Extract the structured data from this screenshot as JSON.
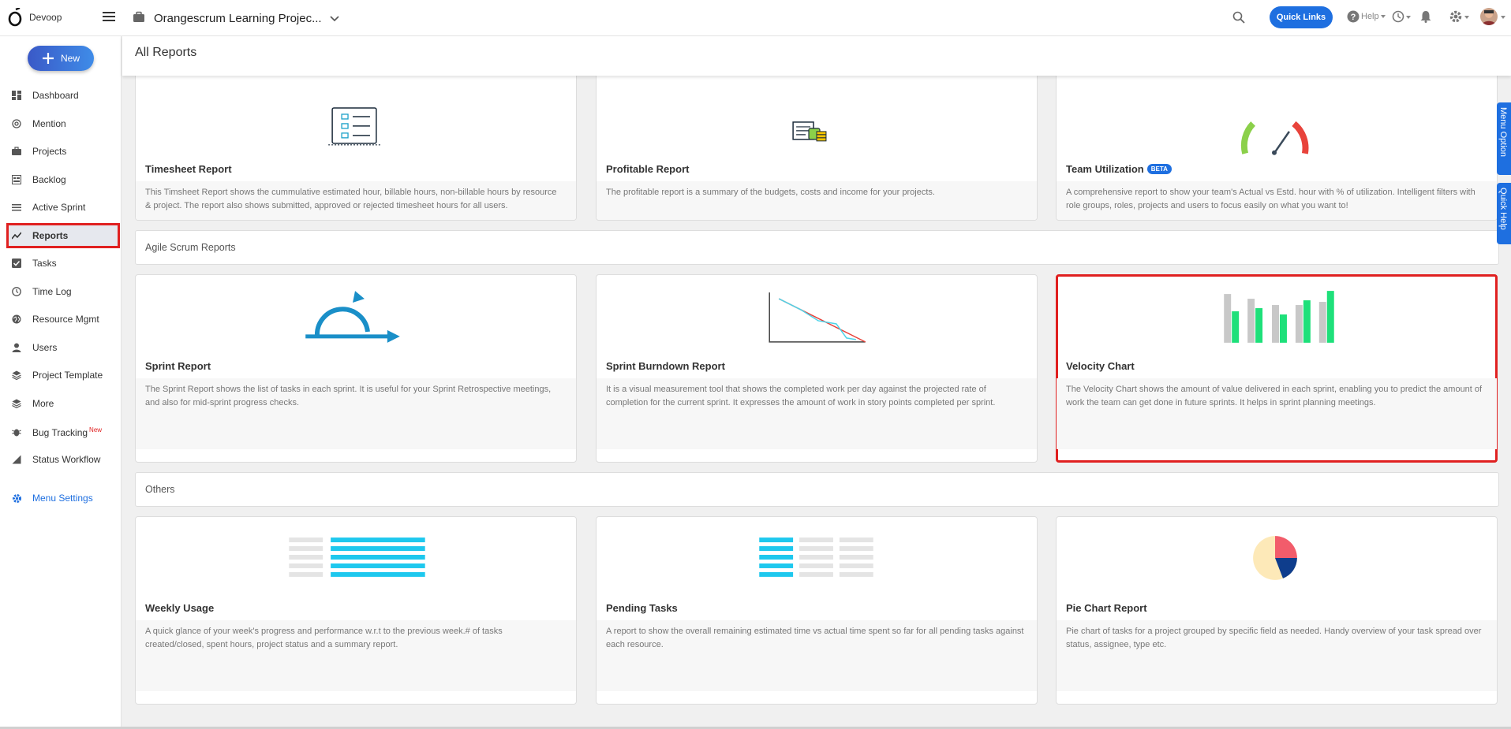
{
  "topbar": {
    "brand": "Devoop",
    "project_name": "Orangescrum Learning Projec...",
    "quick_links": "Quick Links",
    "help": "Help"
  },
  "sidebar": {
    "new_label": "New",
    "items": [
      {
        "label": "Dashboard",
        "icon": "dashboard-icon"
      },
      {
        "label": "Mention",
        "icon": "at-icon"
      },
      {
        "label": "Projects",
        "icon": "briefcase-icon"
      },
      {
        "label": "Backlog",
        "icon": "backlog-icon"
      },
      {
        "label": "Active Sprint",
        "icon": "sprint-icon"
      },
      {
        "label": "Reports",
        "icon": "chart-line-icon"
      },
      {
        "label": "Tasks",
        "icon": "checkbox-icon"
      },
      {
        "label": "Time Log",
        "icon": "clock-icon"
      },
      {
        "label": "Resource Mgmt",
        "icon": "globe-icon"
      },
      {
        "label": "Users",
        "icon": "user-icon"
      },
      {
        "label": "Project Template",
        "icon": "layers-icon"
      },
      {
        "label": "More",
        "icon": "layers-icon"
      },
      {
        "label": "Bug Tracking",
        "icon": "bug-icon",
        "badge": "New"
      },
      {
        "label": "Status Workflow",
        "icon": "workflow-icon"
      }
    ],
    "menu_settings": "Menu Settings"
  },
  "page": {
    "title": "All Reports"
  },
  "sections": {
    "agile": "Agile Scrum Reports",
    "others": "Others"
  },
  "reports": {
    "timesheet": {
      "title": "Timesheet Report",
      "desc": "This Timsheet Report shows the cummulative estimated hour, billable hours, non-billable hours by resource & project. The report also shows submitted, approved or rejected timesheet hours for all users."
    },
    "profitable": {
      "title": "Profitable Report",
      "desc": "The profitable report is a summary of the budgets, costs and income for your projects."
    },
    "team": {
      "title": "Team Utilization",
      "badge": "BETA",
      "desc": "A comprehensive report to show your team's Actual vs Estd. hour with % of utilization. Intelligent filters with role groups, roles, projects and users to focus easily on what you want to!"
    },
    "sprint": {
      "title": "Sprint Report",
      "desc": "The Sprint Report shows the list of tasks in each sprint. It is useful for your Sprint Retrospective meetings, and also for mid-sprint progress checks."
    },
    "burndown": {
      "title": "Sprint Burndown Report",
      "desc": "It is a visual measurement tool that shows the completed work per day against the projected rate of completion for the current sprint. It expresses the amount of work in story points completed per sprint."
    },
    "velocity": {
      "title": "Velocity Chart",
      "desc": "The Velocity Chart shows the amount of value delivered in each sprint, enabling you to predict the amount of work the team can get done in future sprints. It helps in sprint planning meetings."
    },
    "weekly": {
      "title": "Weekly Usage",
      "desc": "A quick glance of your week's progress and performance w.r.t to the previous week.# of tasks created/closed, spent hours, project status and a summary report."
    },
    "pending": {
      "title": "Pending Tasks",
      "desc": "A report to show the overall remaining estimated time vs actual time spent so far for all pending tasks against each resource."
    },
    "pie": {
      "title": "Pie Chart Report",
      "desc": "Pie chart of tasks for a project grouped by specific field as needed. Handy overview of your task spread over status, assignee, type etc."
    }
  },
  "side_tabs": {
    "menu_option": "Menu Option",
    "quick_help": "Quick Help"
  },
  "colors": {
    "accent": "#1e6fe0",
    "highlight": "#e02020",
    "green": "#1ee07a",
    "cyan": "#1ec8ee"
  }
}
